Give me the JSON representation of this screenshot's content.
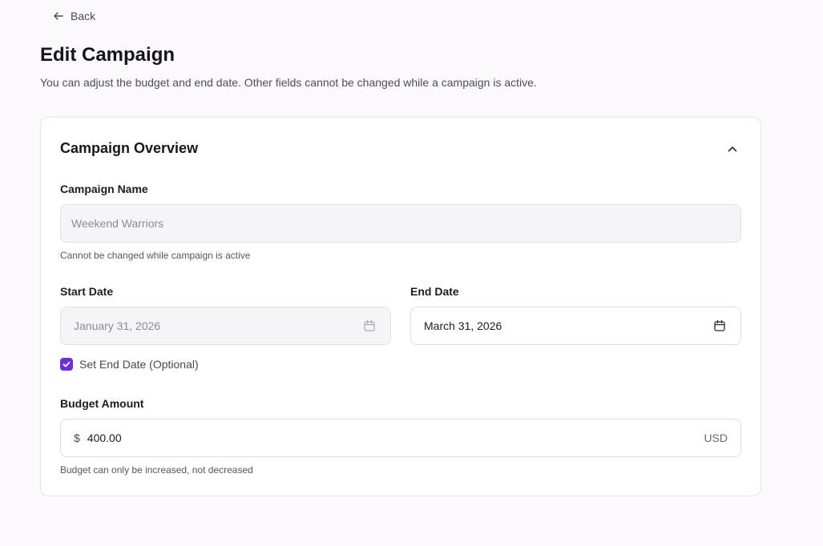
{
  "nav": {
    "back_label": "Back"
  },
  "header": {
    "title": "Edit Campaign",
    "subtitle": "You can adjust the budget and end date. Other fields cannot be changed while a campaign is active."
  },
  "section": {
    "title": "Campaign Overview",
    "expanded": true,
    "campaign_name": {
      "label": "Campaign Name",
      "value": "Weekend Warriors",
      "disabled": true,
      "helper": "Cannot be changed while campaign is active"
    },
    "start_date": {
      "label": "Start Date",
      "value": "January 31, 2026",
      "disabled": true
    },
    "end_date": {
      "label": "End Date",
      "value": "March 31, 2026",
      "disabled": false
    },
    "set_end_date": {
      "label": "Set End Date (Optional)",
      "checked": true
    },
    "budget": {
      "label": "Budget Amount",
      "currency_symbol": "$",
      "value": "400.00",
      "currency_code": "USD",
      "helper": "Budget can only be increased, not decreased"
    }
  },
  "colors": {
    "accent": "#6d2fd6",
    "page_bg": "#fbf9fc",
    "card_bg": "#ffffff",
    "disabled_bg": "#f5f4f6"
  },
  "icons": {
    "back": "arrow-left-icon",
    "collapse": "chevron-up-icon",
    "date": "calendar-icon",
    "check": "check-icon"
  }
}
